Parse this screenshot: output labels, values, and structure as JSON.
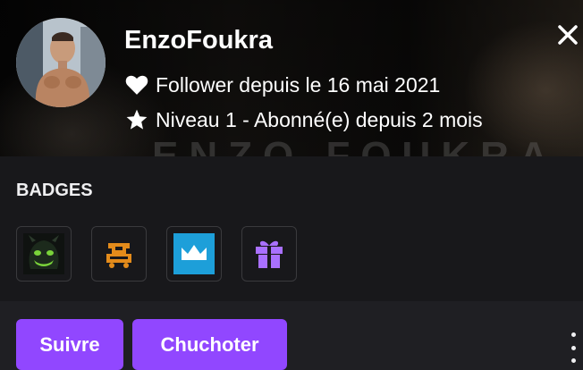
{
  "user": {
    "username": "EnzoFoukra",
    "banner_watermark": "ENZO FOUKRA",
    "follow_text": "Follower depuis le 16 mai 2021",
    "subscription_text": "Niveau 1 - Abonné(e) depuis 2 mois"
  },
  "icons": {
    "follow": "heart-icon",
    "subscription": "star-icon",
    "close": "close-icon",
    "more": "more-vertical-icon"
  },
  "badges": {
    "title": "BADGES",
    "items": [
      {
        "name": "badge-green-creature",
        "color": "#7ad33a"
      },
      {
        "name": "badge-orange-cart",
        "color": "#e38b1b"
      },
      {
        "name": "badge-blue-crown",
        "color": "#1d9fd9"
      },
      {
        "name": "badge-purple-gift",
        "color": "#a970ff"
      }
    ]
  },
  "actions": {
    "follow_label": "Suivre",
    "whisper_label": "Chuchoter"
  },
  "colors": {
    "accent": "#9147ff",
    "background": "#18181b",
    "footer": "#1f1f23",
    "text": "#efeff1"
  }
}
